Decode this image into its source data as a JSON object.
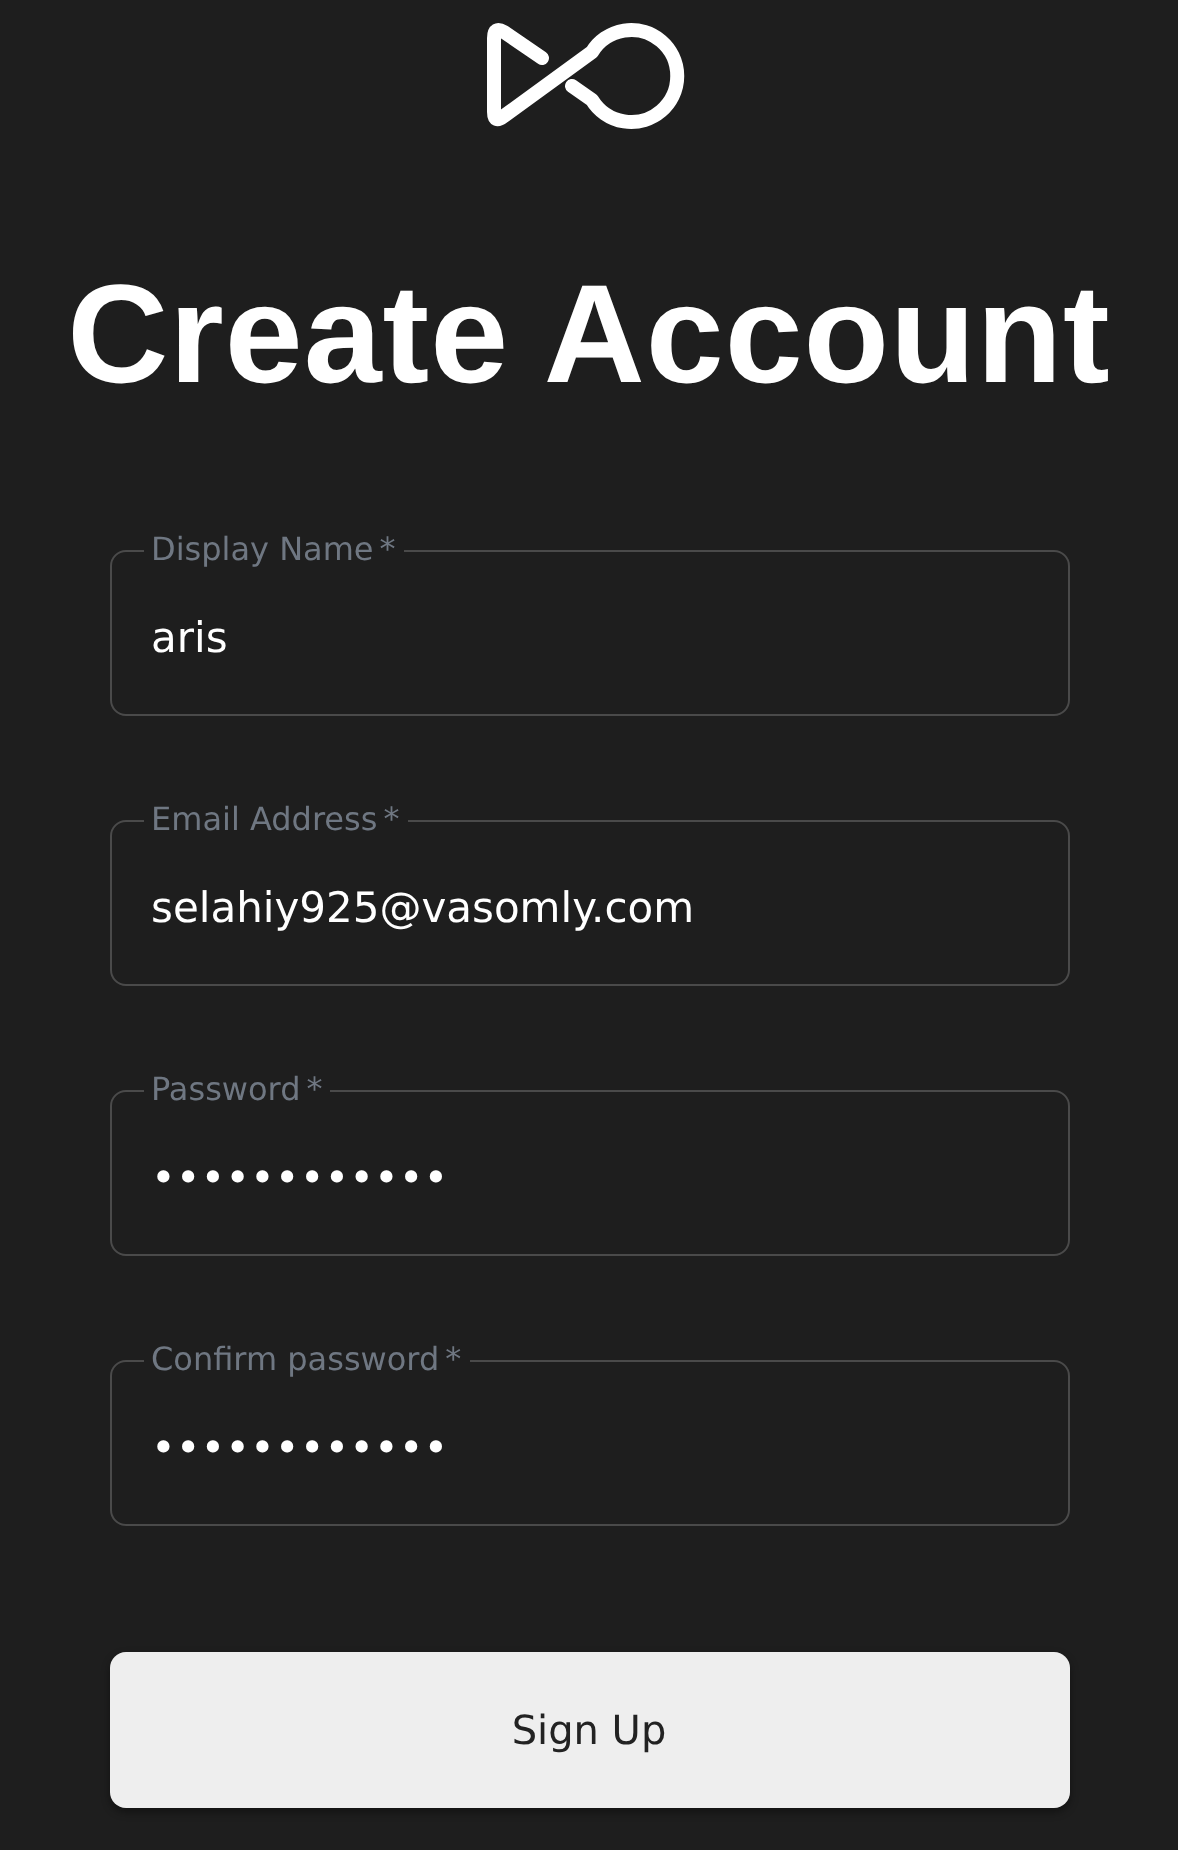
{
  "title": "Create Account",
  "fields": [
    {
      "label": "Display Name",
      "required_mark": "*",
      "value": "aris"
    },
    {
      "label": "Email Address",
      "required_mark": "*",
      "value": "selahiy925@vasomly.com"
    },
    {
      "label": "Password",
      "required_mark": "*",
      "value": "••••••••••••"
    },
    {
      "label": "Confirm password",
      "required_mark": "*",
      "value": "••••••••••••"
    }
  ],
  "submit": "Sign Up"
}
